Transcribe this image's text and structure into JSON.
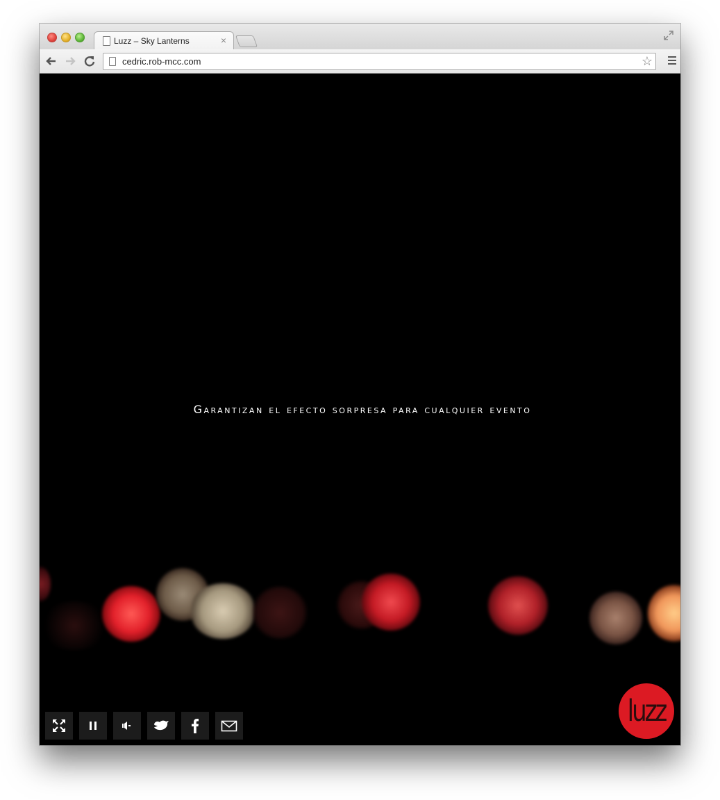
{
  "browser": {
    "tab_title": "Luzz – Sky Lanterns",
    "tab_close_glyph": "×",
    "url": "cedric.rob-mcc.com",
    "icons": {
      "back": "arrow-left-icon",
      "forward": "arrow-right-icon",
      "reload": "reload-icon",
      "bookmark": "star-icon",
      "menu": "hamburger-menu-icon",
      "fullscreen": "fullscreen-icon",
      "page": "page-icon"
    }
  },
  "video": {
    "tagline": "Garantizan el efecto sorpresa para cualquier evento",
    "controls": [
      {
        "id": "fullscreen",
        "icon": "expand-icon"
      },
      {
        "id": "pause",
        "icon": "pause-icon"
      },
      {
        "id": "volume",
        "icon": "volume-icon"
      },
      {
        "id": "twitter",
        "icon": "twitter-bird-icon"
      },
      {
        "id": "facebook",
        "icon": "facebook-icon"
      },
      {
        "id": "email",
        "icon": "envelope-icon"
      }
    ]
  },
  "logo": {
    "text": "luzz",
    "color": "#dc1a23"
  },
  "colors": {
    "background": "#000000",
    "control_bg": "#1c1c1c",
    "text": "#ffffff"
  }
}
